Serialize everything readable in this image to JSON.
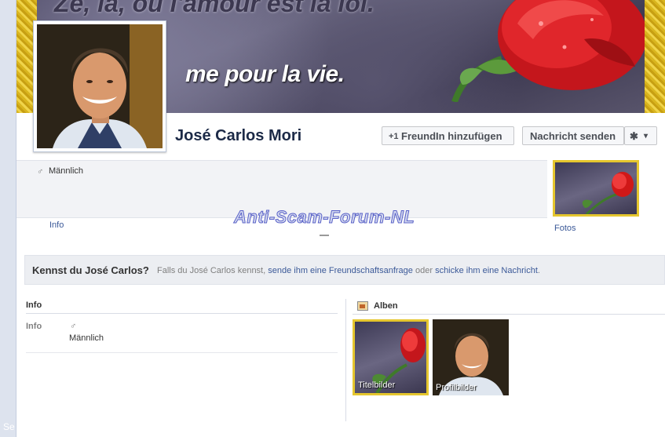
{
  "cover": {
    "text_top": "Ze, la, ou l'amour est la loi.",
    "text": "me pour la vie.",
    "colors": {
      "rose": "#d01818",
      "gold": "#e5c62e"
    }
  },
  "profile": {
    "name": "José Carlos Mori"
  },
  "actions": {
    "add_friend_icon": "+1",
    "add_friend": "FreundIn hinzufügen",
    "send_message": "Nachricht senden",
    "gear_icon": "✱",
    "caret": "▾"
  },
  "about": {
    "gender_icon": "♂",
    "gender": "Männlich",
    "info_link": "Info",
    "photos_link": "Fotos"
  },
  "watermark": "Anti-Scam-Forum-NL",
  "know_bar": {
    "question": "Kennst du José Carlos?",
    "prefix": "Falls du José Carlos kennst,",
    "link1": "sende ihm eine Freundschaftsanfrage",
    "middle": "oder",
    "link2": "schicke ihm eine Nachricht",
    "suffix": "."
  },
  "info_section": {
    "title": "Info",
    "label": "Info",
    "gender_icon": "♂",
    "gender": "Männlich"
  },
  "albums": {
    "title": "Alben",
    "items": [
      {
        "caption": "Titelbilder"
      },
      {
        "caption": "Profilbilder"
      }
    ]
  },
  "left_edge_text": "Se"
}
